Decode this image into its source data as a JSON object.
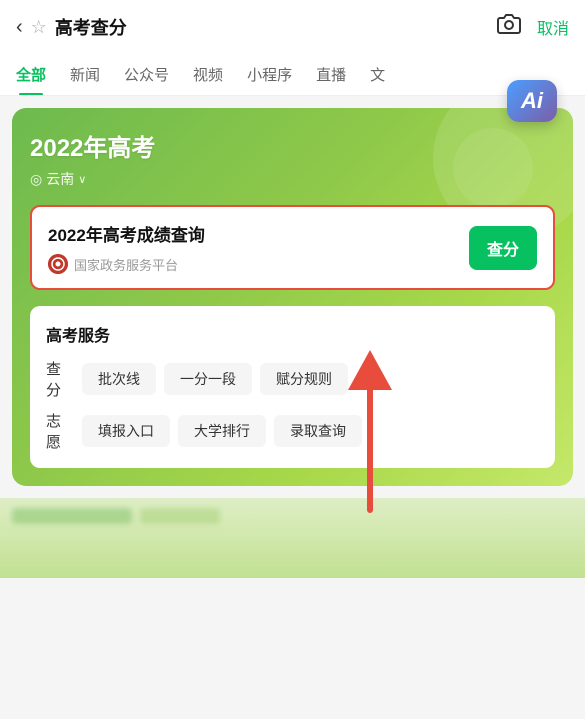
{
  "header": {
    "back_label": "‹",
    "star_label": "☆",
    "title": "高考查分",
    "camera_icon": "📷",
    "cancel_label": "取消"
  },
  "tabs": [
    {
      "id": "all",
      "label": "全部",
      "active": true
    },
    {
      "id": "news",
      "label": "新闻",
      "active": false
    },
    {
      "id": "official",
      "label": "公众号",
      "active": false
    },
    {
      "id": "video",
      "label": "视频",
      "active": false
    },
    {
      "id": "mini",
      "label": "小程序",
      "active": false
    },
    {
      "id": "live",
      "label": "直播",
      "active": false
    },
    {
      "id": "article",
      "label": "文",
      "active": false
    }
  ],
  "card": {
    "year": "2022年高考",
    "location_pin": "◎",
    "location": "云南",
    "chevron": "∨"
  },
  "result_box": {
    "title": "2022年高考成绩查询",
    "source_name": "国家政务服务平台",
    "query_button": "查分"
  },
  "services": {
    "title": "高考服务",
    "rows": [
      {
        "label": "查分",
        "tags": [
          "批次线",
          "一分一段",
          "赋分规则"
        ]
      },
      {
        "label": "志愿",
        "tags": [
          "填报入口",
          "大学排行",
          "录取查询"
        ]
      }
    ]
  },
  "ai": {
    "label": "Ai"
  }
}
